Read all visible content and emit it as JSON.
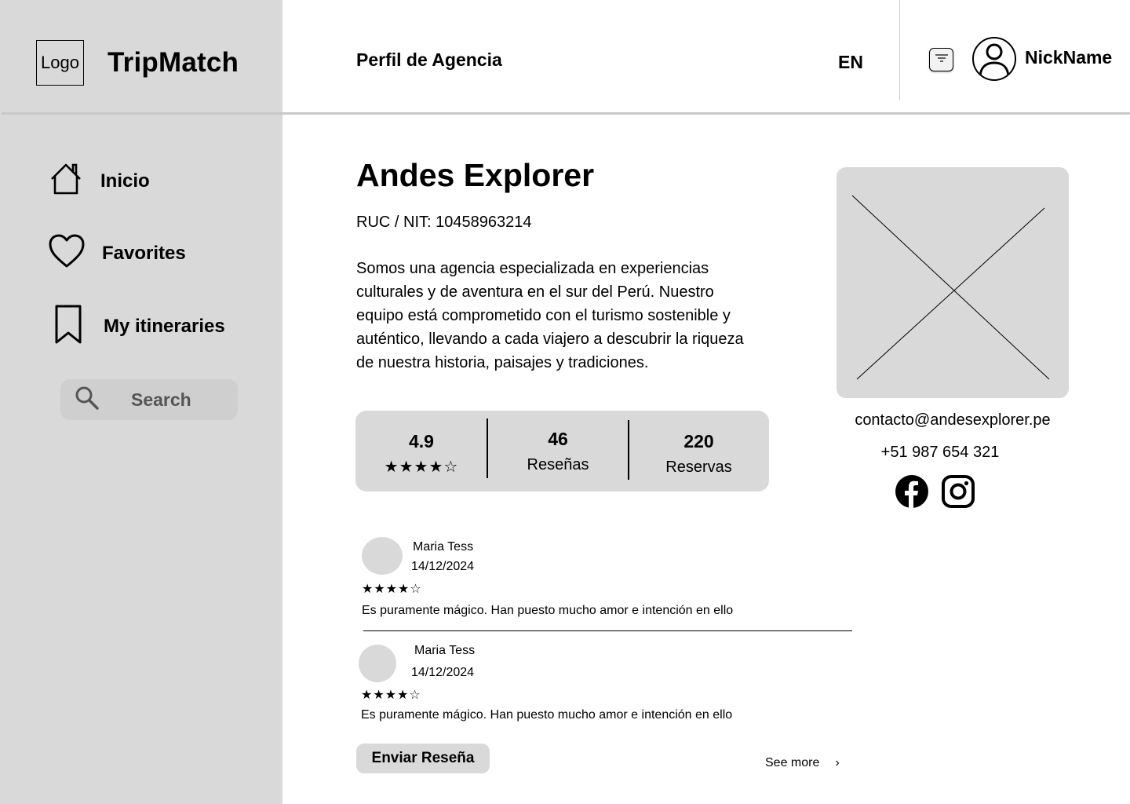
{
  "sidebar": {
    "logo_text": "Logo",
    "brand": "TripMatch",
    "items": [
      {
        "label": "Inicio",
        "icon": "home-icon"
      },
      {
        "label": "Favorites",
        "icon": "heart-icon"
      },
      {
        "label": "My itineraries",
        "icon": "bookmark-icon"
      }
    ],
    "search": {
      "label": "Search",
      "icon": "search-icon"
    }
  },
  "header": {
    "title": "Perfil de Agencia",
    "language": "EN",
    "filter_icon": "filter-icon",
    "avatar_icon": "user-avatar-icon",
    "nickname": "NickName"
  },
  "agency": {
    "name": "Andes Explorer",
    "ruc": "RUC / NIT: 10458963214",
    "description": "Somos una agencia especializada en experiencias culturales y de aventura en el sur del Perú. Nuestro equipo está comprometido con el turismo sostenible y auténtico, llevando a cada viajero a descubrir la riqueza de nuestra historia, paisajes y tradiciones.",
    "image_icon": "image-placeholder-icon",
    "email": "contacto@andesexplorer.pe",
    "phone": "+51 987 654 321",
    "social": [
      "facebook-icon",
      "instagram-icon"
    ]
  },
  "stats": {
    "rating": "4.9",
    "rating_stars": "★★★★☆",
    "reviews_value": "46",
    "reviews_label": "Reseñas",
    "bookings_value": "220",
    "bookings_label": "Reservas"
  },
  "reviews": [
    {
      "name": "Maria Tess",
      "date": "14/12/2024",
      "stars": "★★★★☆",
      "text": "Es puramente mágico. Han puesto mucho amor e intención en ello"
    },
    {
      "name": "Maria Tess",
      "date": "14/12/2024",
      "stars": "★★★★☆",
      "text": "Es puramente mágico. Han puesto mucho amor e intención en ello"
    }
  ],
  "actions": {
    "send_review": "Enviar Reseña",
    "see_more": "See more",
    "see_more_icon": "chevron-right-icon",
    "chevron": "›"
  }
}
